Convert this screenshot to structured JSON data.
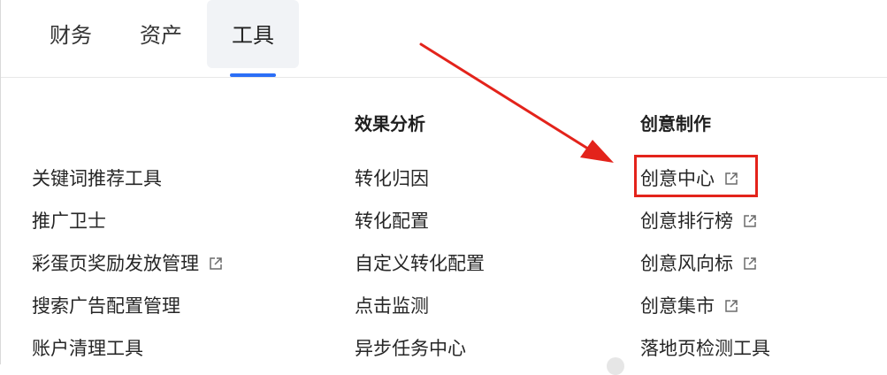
{
  "tabs": [
    {
      "label": "财务"
    },
    {
      "label": "资产"
    },
    {
      "label": "工具",
      "active": true
    }
  ],
  "columns": [
    {
      "title": "",
      "items": [
        {
          "label": "关键词推荐工具",
          "external": false
        },
        {
          "label": "推广卫士",
          "external": false
        },
        {
          "label": "彩蛋页奖励发放管理",
          "external": true
        },
        {
          "label": "搜索广告配置管理",
          "external": false
        },
        {
          "label": "账户清理工具",
          "external": false
        }
      ]
    },
    {
      "title": "效果分析",
      "items": [
        {
          "label": "转化归因",
          "external": false
        },
        {
          "label": "转化配置",
          "external": false
        },
        {
          "label": "自定义转化配置",
          "external": false
        },
        {
          "label": "点击监测",
          "external": false
        },
        {
          "label": "异步任务中心",
          "external": false
        }
      ]
    },
    {
      "title": "创意制作",
      "items": [
        {
          "label": "创意中心",
          "external": true
        },
        {
          "label": "创意排行榜",
          "external": true
        },
        {
          "label": "创意风向标",
          "external": true
        },
        {
          "label": "创意集市",
          "external": true
        },
        {
          "label": "落地页检测工具",
          "external": false
        }
      ]
    }
  ],
  "colors": {
    "accent": "#2b6ef6",
    "annotation": "#e3231b",
    "active_tab_bg": "#f1f3f6"
  },
  "icons": {
    "external": "external-link-icon",
    "annotation": "red-arrow"
  }
}
